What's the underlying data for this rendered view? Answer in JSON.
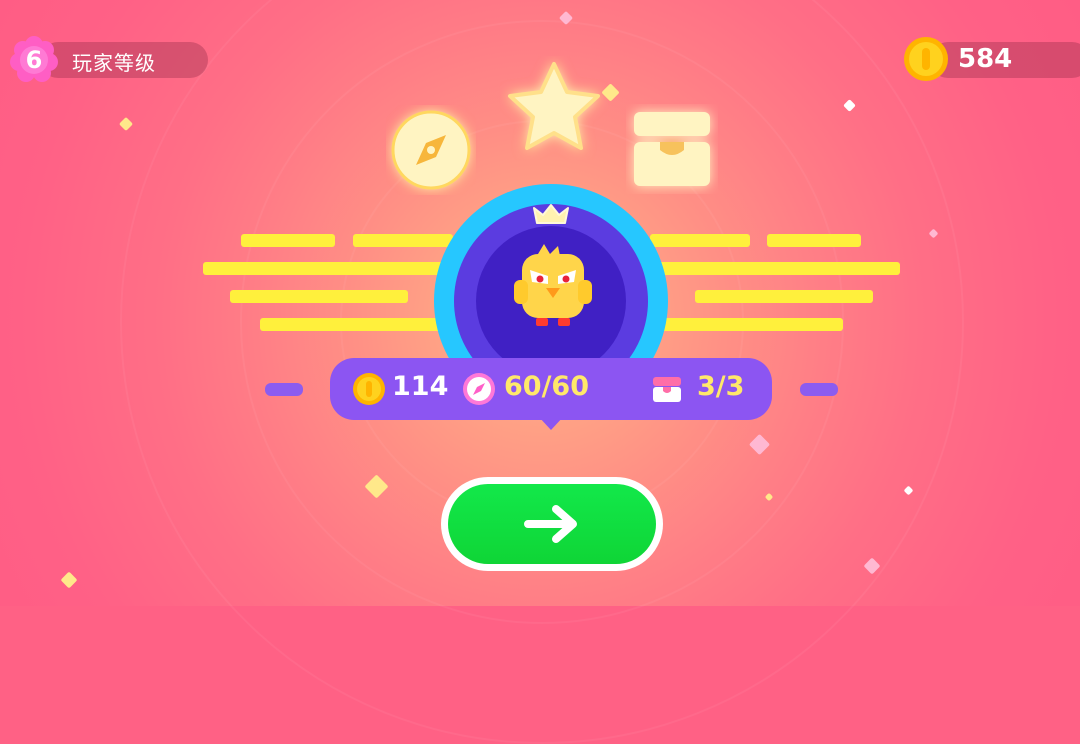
{
  "player": {
    "level": "6",
    "level_label": "玩家等级"
  },
  "currency": {
    "coins": "584",
    "icon": "coin-icon"
  },
  "header_icons": [
    "compass-icon",
    "star-icon",
    "chest-icon"
  ],
  "stats": {
    "coins_earned": "114",
    "compass_progress": "60/60",
    "chest_progress": "3/3"
  },
  "next_button": {
    "icon": "arrow-right-icon"
  },
  "colors": {
    "background": "#ff6185",
    "wing": "#fff03c",
    "avatar_ring": "#26c7ff",
    "avatar_fill": "#4020c4",
    "stats_bar": "#8c55f2",
    "button": "#0fd536",
    "stat_highlight": "#ffe86a"
  }
}
